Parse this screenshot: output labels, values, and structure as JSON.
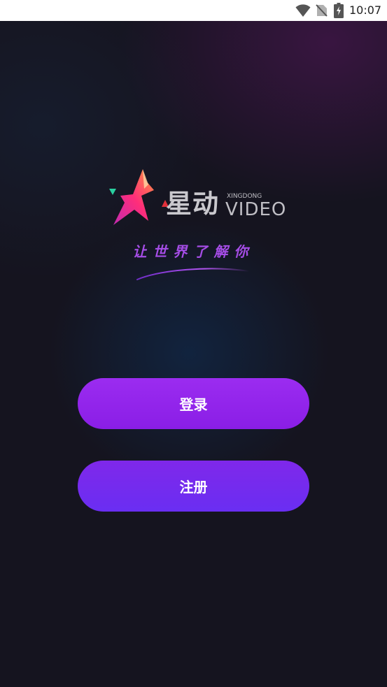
{
  "status_bar": {
    "time": "10:07",
    "icons": [
      "wifi-icon",
      "no-sim-icon",
      "battery-charging-icon"
    ]
  },
  "brand": {
    "name_cn": "星动",
    "name_pinyin": "XINGDONG",
    "name_en": "VIDEO",
    "logo_icon": "star-logo-icon"
  },
  "slogan": "让世界了解你",
  "actions": {
    "login_label": "登录",
    "register_label": "注册"
  },
  "colors": {
    "background": "#15141f",
    "accent": "#8a1ee6",
    "slogan": "#a54de6"
  }
}
